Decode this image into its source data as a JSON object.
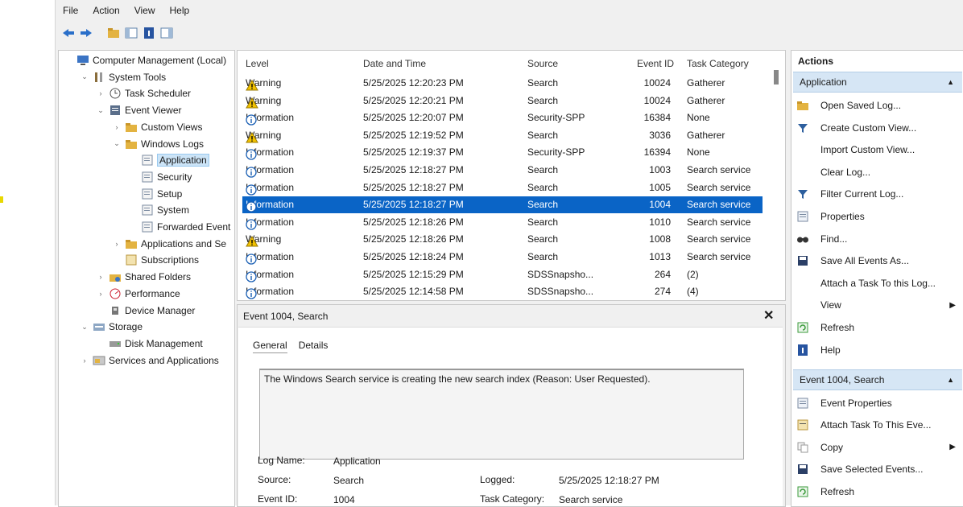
{
  "menu": [
    "File",
    "Action",
    "View",
    "Help"
  ],
  "tree": [
    {
      "label": "Computer Management (Local)",
      "depth": 0,
      "tw": "",
      "icon": "computer-icon"
    },
    {
      "label": "System Tools",
      "depth": 1,
      "tw": "v",
      "icon": "tools-icon"
    },
    {
      "label": "Task Scheduler",
      "depth": 2,
      "tw": ">",
      "icon": "clock-icon"
    },
    {
      "label": "Event Viewer",
      "depth": 2,
      "tw": "v",
      "icon": "event-viewer-icon"
    },
    {
      "label": "Custom Views",
      "depth": 3,
      "tw": ">",
      "icon": "folder-icon"
    },
    {
      "label": "Windows Logs",
      "depth": 3,
      "tw": "v",
      "icon": "folder-icon"
    },
    {
      "label": "Application",
      "depth": 4,
      "tw": "",
      "icon": "log-icon",
      "selected": true
    },
    {
      "label": "Security",
      "depth": 4,
      "tw": "",
      "icon": "log-icon"
    },
    {
      "label": "Setup",
      "depth": 4,
      "tw": "",
      "icon": "log-icon"
    },
    {
      "label": "System",
      "depth": 4,
      "tw": "",
      "icon": "log-icon"
    },
    {
      "label": "Forwarded Event",
      "depth": 4,
      "tw": "",
      "icon": "log-icon"
    },
    {
      "label": "Applications and Se",
      "depth": 3,
      "tw": ">",
      "icon": "folder-icon"
    },
    {
      "label": "Subscriptions",
      "depth": 3,
      "tw": "",
      "icon": "subscription-icon"
    },
    {
      "label": "Shared Folders",
      "depth": 2,
      "tw": ">",
      "icon": "shared-folder-icon"
    },
    {
      "label": "Performance",
      "depth": 2,
      "tw": ">",
      "icon": "performance-icon"
    },
    {
      "label": "Device Manager",
      "depth": 2,
      "tw": "",
      "icon": "device-manager-icon"
    },
    {
      "label": "Storage",
      "depth": 1,
      "tw": "v",
      "icon": "storage-icon"
    },
    {
      "label": "Disk Management",
      "depth": 2,
      "tw": "",
      "icon": "disk-icon"
    },
    {
      "label": "Services and Applications",
      "depth": 1,
      "tw": ">",
      "icon": "services-icon"
    }
  ],
  "list": {
    "headers": [
      "Level",
      "Date and Time",
      "Source",
      "Event ID",
      "Task Category"
    ],
    "rows": [
      {
        "level": "Warning",
        "date": "5/25/2025 12:20:23 PM",
        "source": "Search",
        "id": "10024",
        "cat": "Gatherer"
      },
      {
        "level": "Warning",
        "date": "5/25/2025 12:20:21 PM",
        "source": "Search",
        "id": "10024",
        "cat": "Gatherer"
      },
      {
        "level": "Information",
        "date": "5/25/2025 12:20:07 PM",
        "source": "Security-SPP",
        "id": "16384",
        "cat": "None"
      },
      {
        "level": "Warning",
        "date": "5/25/2025 12:19:52 PM",
        "source": "Search",
        "id": "3036",
        "cat": "Gatherer"
      },
      {
        "level": "Information",
        "date": "5/25/2025 12:19:37 PM",
        "source": "Security-SPP",
        "id": "16394",
        "cat": "None"
      },
      {
        "level": "Information",
        "date": "5/25/2025 12:18:27 PM",
        "source": "Search",
        "id": "1003",
        "cat": "Search service"
      },
      {
        "level": "Information",
        "date": "5/25/2025 12:18:27 PM",
        "source": "Search",
        "id": "1005",
        "cat": "Search service"
      },
      {
        "level": "Information",
        "date": "5/25/2025 12:18:27 PM",
        "source": "Search",
        "id": "1004",
        "cat": "Search service",
        "selected": true
      },
      {
        "level": "Information",
        "date": "5/25/2025 12:18:26 PM",
        "source": "Search",
        "id": "1010",
        "cat": "Search service"
      },
      {
        "level": "Warning",
        "date": "5/25/2025 12:18:26 PM",
        "source": "Search",
        "id": "1008",
        "cat": "Search service"
      },
      {
        "level": "Information",
        "date": "5/25/2025 12:18:24 PM",
        "source": "Search",
        "id": "1013",
        "cat": "Search service"
      },
      {
        "level": "Information",
        "date": "5/25/2025 12:15:29 PM",
        "source": "SDSSnapsho...",
        "id": "264",
        "cat": "(2)"
      },
      {
        "level": "Information",
        "date": "5/25/2025 12:14:58 PM",
        "source": "SDSSnapsho...",
        "id": "274",
        "cat": "(4)"
      }
    ]
  },
  "detail": {
    "title": "Event 1004, Search",
    "close": "✕",
    "tabs": [
      "General",
      "Details"
    ],
    "message": "The Windows Search service is creating the new search index (Reason: User Requested).",
    "log_name_label": "Log Name:",
    "log_name": "Application",
    "source_label": "Source:",
    "source": "Search",
    "logged_label": "Logged:",
    "logged": "5/25/2025 12:18:27 PM",
    "event_id_label": "Event ID:",
    "event_id": "1004",
    "task_cat_label": "Task Category:",
    "task_cat": "Search service"
  },
  "actions": {
    "header": "Actions",
    "section1": "Application",
    "section1_items": [
      {
        "label": "Open Saved Log...",
        "icon": "open-log-icon"
      },
      {
        "label": "Create Custom View...",
        "icon": "filter-icon"
      },
      {
        "label": "Import Custom View...",
        "icon": ""
      },
      {
        "label": "Clear Log...",
        "icon": ""
      },
      {
        "label": "Filter Current Log...",
        "icon": "filter-icon"
      },
      {
        "label": "Properties",
        "icon": "properties-icon"
      },
      {
        "label": "Find...",
        "icon": "find-icon"
      },
      {
        "label": "Save All Events As...",
        "icon": "save-icon"
      },
      {
        "label": "Attach a Task To this Log...",
        "icon": ""
      },
      {
        "label": "View",
        "icon": "",
        "submenu": true
      },
      {
        "label": "Refresh",
        "icon": "refresh-icon"
      },
      {
        "label": "Help",
        "icon": "help-icon"
      }
    ],
    "section2": "Event 1004, Search",
    "section2_items": [
      {
        "label": "Event Properties",
        "icon": "properties-icon"
      },
      {
        "label": "Attach Task To This Eve...",
        "icon": "task-icon"
      },
      {
        "label": "Copy",
        "icon": "copy-icon",
        "submenu": true
      },
      {
        "label": "Save Selected Events...",
        "icon": "save-icon"
      },
      {
        "label": "Refresh",
        "icon": "refresh-icon"
      }
    ]
  },
  "colors": {
    "selection": "#0a64c6",
    "section_bg": "#d6e6f5",
    "warning": "#f2c200",
    "info": "#1a5fb4"
  }
}
